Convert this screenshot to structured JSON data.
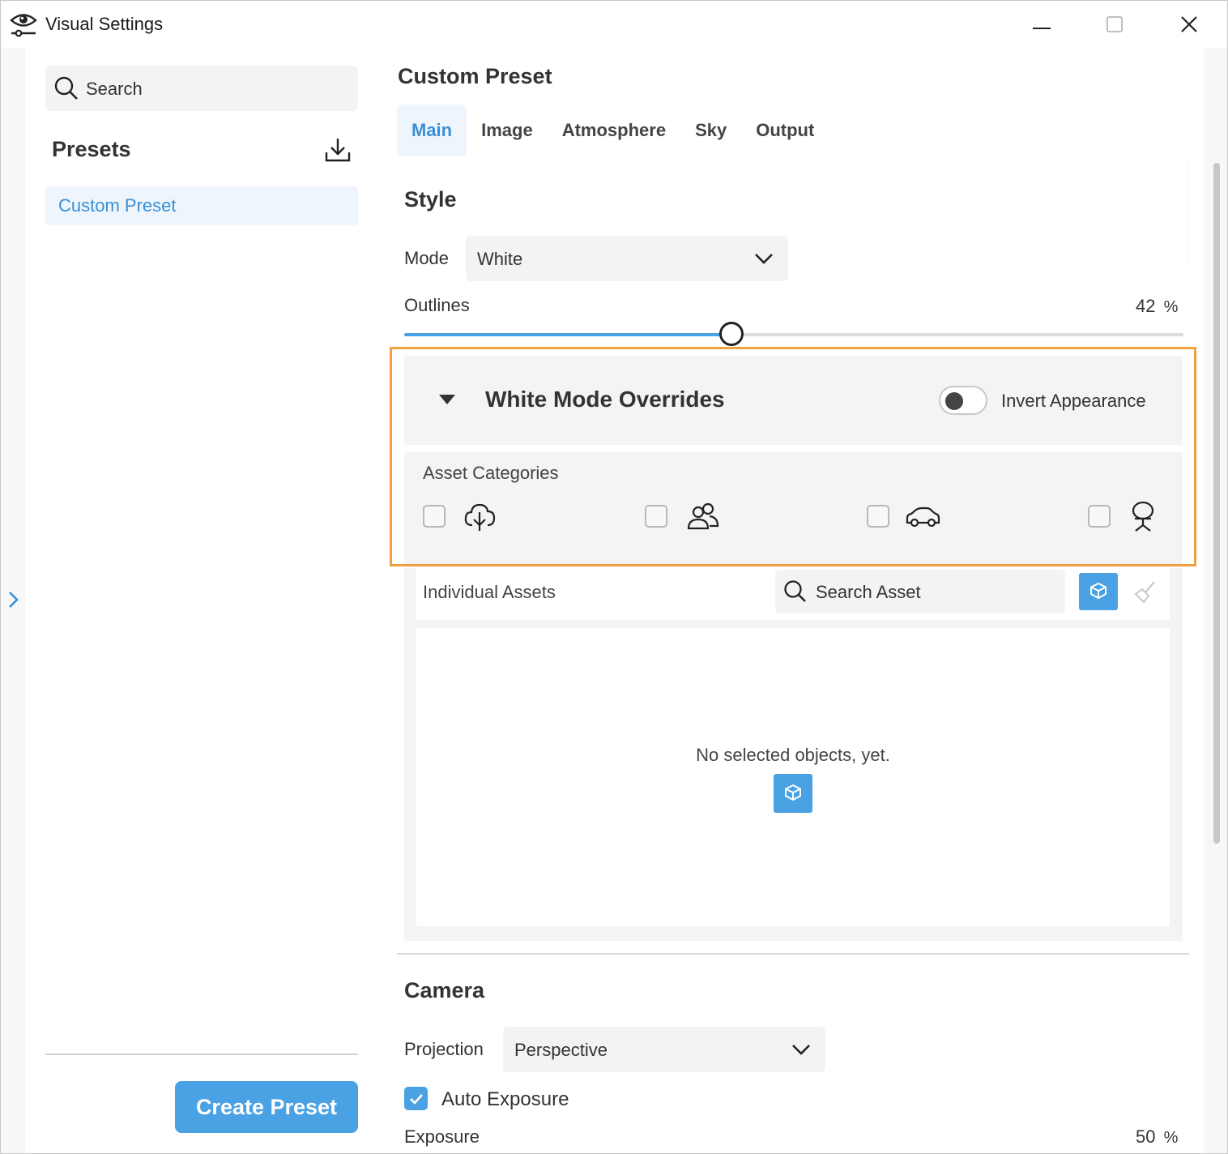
{
  "window": {
    "title": "Visual Settings",
    "controls": [
      "minimize",
      "maximize",
      "close"
    ]
  },
  "sidebar": {
    "search_placeholder": "Search",
    "presets_title": "Presets",
    "presets": [
      {
        "label": "Custom Preset",
        "selected": true
      }
    ],
    "create_button": "Create Preset"
  },
  "main": {
    "title": "Custom Preset",
    "tabs": [
      {
        "label": "Main",
        "active": true
      },
      {
        "label": "Image",
        "active": false
      },
      {
        "label": "Atmosphere",
        "active": false
      },
      {
        "label": "Sky",
        "active": false
      },
      {
        "label": "Output",
        "active": false
      }
    ],
    "style": {
      "heading": "Style",
      "mode_label": "Mode",
      "mode_value": "White",
      "outlines_label": "Outlines",
      "outlines_value": "42",
      "outlines_unit": "%",
      "outlines_fraction": 0.42
    },
    "overrides": {
      "title": "White Mode Overrides",
      "expanded": true,
      "invert_label": "Invert Appearance",
      "invert_on": false,
      "categories_label": "Asset Categories",
      "categories": [
        {
          "icon": "tree-icon",
          "checked": false
        },
        {
          "icon": "people-icon",
          "checked": false
        },
        {
          "icon": "car-icon",
          "checked": false
        },
        {
          "icon": "chair-icon",
          "checked": false
        }
      ],
      "individual_label": "Individual Assets",
      "search_placeholder": "Search Asset",
      "empty_text": "No selected objects, yet."
    },
    "camera": {
      "heading": "Camera",
      "projection_label": "Projection",
      "projection_value": "Perspective",
      "auto_exposure_label": "Auto Exposure",
      "auto_exposure_checked": true,
      "exposure_label": "Exposure",
      "exposure_value": "50",
      "exposure_unit": "%"
    }
  },
  "colors": {
    "accent": "#4aa1e3",
    "highlight": "#f0a040",
    "panel": "#f4f4f4"
  }
}
